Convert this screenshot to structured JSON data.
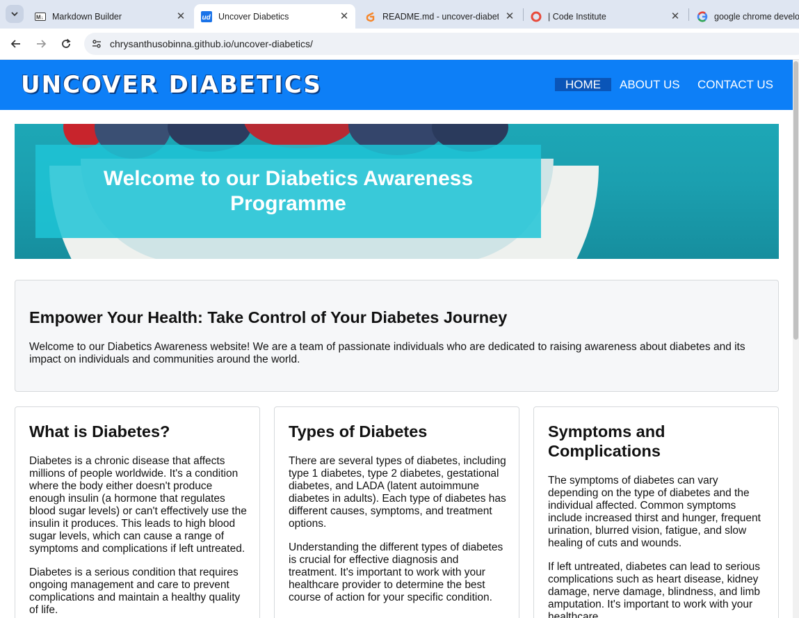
{
  "browser": {
    "tabs": [
      {
        "title": "Markdown Builder",
        "favicon": "markdown-icon",
        "active": false
      },
      {
        "title": "Uncover Diabetics",
        "favicon": "ud-icon",
        "active": true
      },
      {
        "title": "README.md - uncover-diabetics",
        "favicon": "gitpod-icon",
        "active": false
      },
      {
        "title": "| Code Institute",
        "favicon": "code-institute-icon",
        "active": false
      },
      {
        "title": "google chrome developer tools",
        "favicon": "google-icon",
        "active": false
      }
    ],
    "url": "chrysanthusobinna.github.io/uncover-diabetics/"
  },
  "site": {
    "brand": "UNCOVER DIABETICS",
    "nav": [
      "HOME",
      "ABOUT US",
      "CONTACT US"
    ],
    "hero_title": "Welcome to our Diabetics Awareness Programme",
    "intro": {
      "heading": "Empower Your Health: Take Control of Your Diabetes Journey",
      "text": "Welcome to our Diabetics Awareness website! We are a team of passionate individuals who are dedicated to raising awareness about diabetes and its impact on individuals and communities around the world."
    },
    "columns": [
      {
        "heading": "What is Diabetes?",
        "paragraphs": [
          "Diabetes is a chronic disease that affects millions of people worldwide. It's a condition where the body either doesn't produce enough insulin (a hormone that regulates blood sugar levels) or can't effectively use the insulin it produces. This leads to high blood sugar levels, which can cause a range of symptoms and complications if left untreated.",
          "Diabetes is a serious condition that requires ongoing management and care to prevent complications and maintain a healthy quality of life."
        ]
      },
      {
        "heading": "Types of Diabetes",
        "paragraphs": [
          "There are several types of diabetes, including type 1 diabetes, type 2 diabetes, gestational diabetes, and LADA (latent autoimmune diabetes in adults). Each type of diabetes has different causes, symptoms, and treatment options.",
          "Understanding the different types of diabetes is crucial for effective diagnosis and treatment. It's important to work with your healthcare provider to determine the best course of action for your specific condition."
        ]
      },
      {
        "heading": "Symptoms and Complications",
        "paragraphs": [
          "The symptoms of diabetes can vary depending on the type of diabetes and the individual affected. Common symptoms include increased thirst and hunger, frequent urination, blurred vision, fatigue, and slow healing of cuts and wounds.",
          "If left untreated, diabetes can lead to serious complications such as heart disease, kidney damage, nerve damage, blindness, and limb amputation. It's important to work with your healthcare"
        ]
      }
    ]
  },
  "colors": {
    "header_blue": "#0d7ff7",
    "nav_active": "#0a55b8",
    "welcome_box": "#1ec4d6",
    "hero_bg": "#1b9faf"
  }
}
